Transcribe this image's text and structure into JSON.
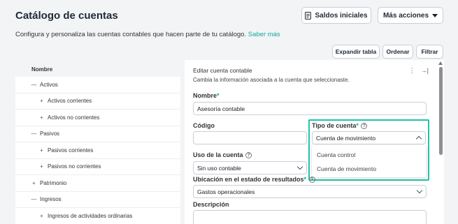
{
  "header": {
    "title": "Catálogo de cuentas",
    "saldos_label": "Saldos iniciales",
    "mas_acciones_label": "Más acciones",
    "description": "Configura y personaliza las cuentas contables que hacen parte de tu catálogo.",
    "learn_more": "Saber más"
  },
  "toolbar": {
    "expand_label": "Expandir tabla",
    "sort_label": "Ordenar",
    "filter_label": "Filtrar"
  },
  "tree": {
    "header": "Nombre",
    "items": [
      {
        "symbol": "—",
        "label": "Activos"
      },
      {
        "symbol": "+",
        "label": "Activos corrientes"
      },
      {
        "symbol": "+",
        "label": "Activos no corrientes"
      },
      {
        "symbol": "—",
        "label": "Pasivos"
      },
      {
        "symbol": "+",
        "label": "Pasivos corrientes"
      },
      {
        "symbol": "+",
        "label": "Pasivos no corrientes"
      },
      {
        "symbol": "+",
        "label": "Patrimonio"
      },
      {
        "symbol": "—",
        "label": "Ingresos"
      },
      {
        "symbol": "+",
        "label": "Ingresos de actividades ordinarias"
      }
    ]
  },
  "editor": {
    "title": "Editar cuenta contable",
    "subtitle": "Cambia la información asociada a la cuenta que seleccionaste.",
    "more_icon": "⋮",
    "collapse_icon": "→|",
    "name_label": "Nombre",
    "required_mark": "*",
    "name_value": "Asesoría contable",
    "code_label": "Código",
    "code_value": "",
    "type_label": "Tipo de cuenta",
    "type_value": "Cuenta de movimiento",
    "type_options": [
      "Cuenta control",
      "Cuenta de movimiento"
    ],
    "use_label": "Uso de la cuenta",
    "use_value": "Sin uso contable",
    "location_label": "Ubicación en el estado de resultados",
    "location_value": "Gastos operacionales",
    "description_label": "Descripción",
    "help_icon": "?"
  },
  "colors": {
    "accent": "#0fa89a",
    "highlight": "#20c3aa"
  }
}
